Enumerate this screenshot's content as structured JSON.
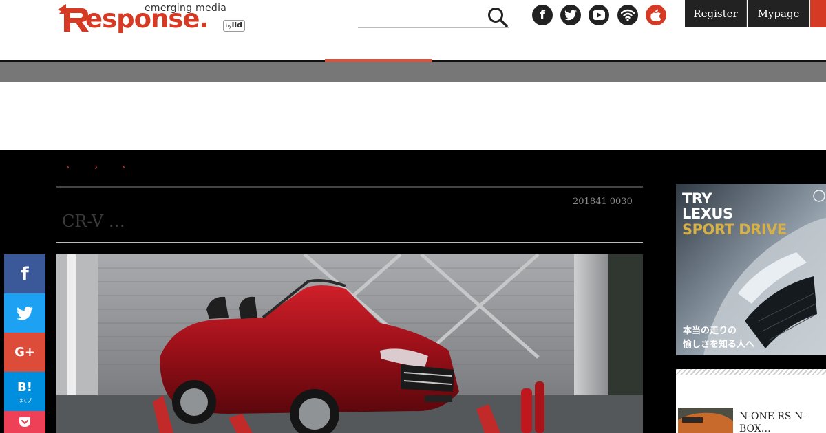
{
  "header": {
    "logo": {
      "tagline": "emerging media",
      "wordmark": "esponse.",
      "by": "by",
      "iid": "iid"
    },
    "search": {
      "placeholder": ""
    },
    "social": [
      {
        "name": "facebook-icon",
        "glyph": "f",
        "bg": "#222222"
      },
      {
        "name": "twitter-icon",
        "glyph": "",
        "bg": "#222222"
      },
      {
        "name": "youtube-icon",
        "glyph": "",
        "bg": "#222222"
      },
      {
        "name": "rss-icon",
        "glyph": "",
        "bg": "#222222"
      },
      {
        "name": "apple-icon",
        "glyph": "",
        "bg": "#d53a24"
      }
    ],
    "register_label": "Register",
    "mypage_label": "Mypage"
  },
  "colors": {
    "brand": "#d53a24",
    "dark": "#222222",
    "nav_gray": "#777777"
  },
  "breadcrumb": {
    "separator": "›"
  },
  "article": {
    "date": "201841 0030",
    "title": "CR-V …"
  },
  "share": [
    {
      "name": "facebook-share",
      "glyph": "f",
      "bg": "#3b5998"
    },
    {
      "name": "twitter-share",
      "glyph": "",
      "bg": "#1da1f2"
    },
    {
      "name": "googleplus-share",
      "glyph": "G+",
      "bg": "#dd4b39"
    },
    {
      "name": "hatena-share",
      "glyph": "B!",
      "sub": "はてブ",
      "bg": "#008fde"
    },
    {
      "name": "pocket-share",
      "glyph": "",
      "bg": "#ee4056"
    }
  ],
  "sidebar": {
    "ad": {
      "line1": "TRY",
      "line2": "LEXUS",
      "line3": "SPORT DRIVE",
      "jp1": "本当の走りの",
      "jp2": "愉しさを知る人へ"
    },
    "ranking": [
      {
        "title": "N-ONE RS  N-BOX…"
      }
    ]
  }
}
